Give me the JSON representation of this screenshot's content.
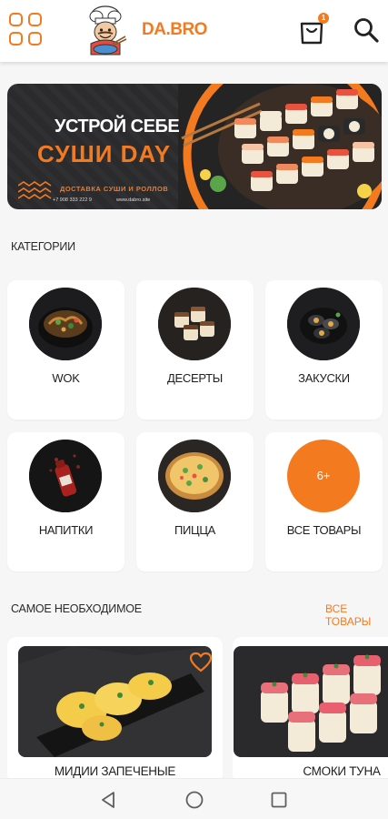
{
  "header": {
    "brand": "DA.BRO",
    "cart_count": "1",
    "icons": [
      "menu-grid-icon",
      "chef-logo",
      "shopping-bag-icon",
      "search-icon"
    ]
  },
  "banner": {
    "title_line1": "УСТРОЙ СЕБЕ",
    "title_line2": "СУШИ DAY",
    "subtitle": "ДОСТАВКА СУШИ И РОЛЛОВ",
    "phone": "+7 908 333 222 9",
    "site": "www.dabro.site"
  },
  "categories": {
    "title": "КАТЕГОРИИ",
    "items": [
      {
        "label": "WOK"
      },
      {
        "label": "ДЕСЕРТЫ"
      },
      {
        "label": "ЗАКУСКИ"
      },
      {
        "label": "НАПИТКИ"
      },
      {
        "label": "ПИЦЦА"
      },
      {
        "label": "ВСЕ ТОВАРЫ",
        "badge": "6+"
      }
    ]
  },
  "essentials": {
    "title": "САМОЕ НЕОБХОДИМОЕ",
    "see_all": "ВСЕ ТОВАРЫ",
    "products": [
      {
        "name": "МИДИИ ЗАПЕЧЕНЫЕ"
      },
      {
        "name": "СМОКИ ТУНА"
      }
    ]
  },
  "colors": {
    "accent": "#f47a20",
    "background": "#f6f6f7",
    "card": "#ffffff",
    "banner_bg": "#2b2b2d"
  },
  "navbar": {
    "icons": [
      "back-triangle-icon",
      "home-circle-icon",
      "recents-square-icon"
    ]
  }
}
